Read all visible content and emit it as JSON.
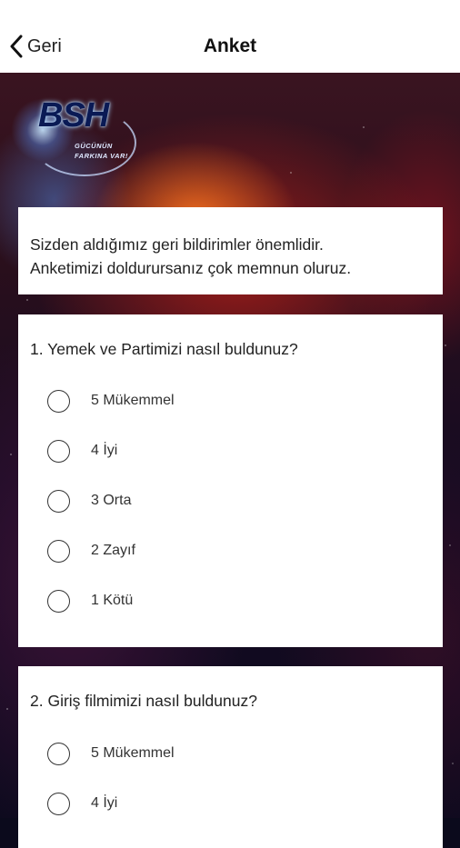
{
  "nav": {
    "back_label": "Geri",
    "title": "Anket"
  },
  "logo": {
    "main": "BSH",
    "line1": "GÜCÜNÜN",
    "line2": "FARKINA VAR!"
  },
  "intro": {
    "line1": "Sizden aldığımız geri bildirimler önemlidir.",
    "line2": "Anketimizi doldurursanız çok memnun oluruz."
  },
  "questions": [
    {
      "title": "1. Yemek ve Partimizi nasıl buldunuz?",
      "options": [
        "5 Mükemmel",
        "4 İyi",
        "3 Orta",
        "2 Zayıf",
        "1 Kötü"
      ]
    },
    {
      "title": "2. Giriş filmimizi nasıl buldunuz?",
      "options": [
        "5 Mükemmel",
        "4 İyi"
      ]
    }
  ],
  "colors": {
    "nav_background": "#ffffff",
    "card_background": "#ffffff",
    "text": "#222222"
  },
  "icons": {
    "back": "chevron-left-icon",
    "radio": "radio-unchecked-icon"
  }
}
